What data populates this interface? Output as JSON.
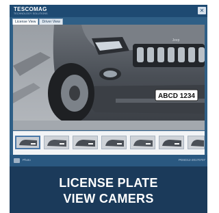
{
  "app": {
    "brand": "TESCOMAG",
    "brand_sub": "TECHNOLOGY SOLUTIONS",
    "window_button": "✕",
    "tabs": [
      {
        "label": "License View",
        "active": true
      },
      {
        "label": "Driver View",
        "active": false
      }
    ],
    "plate_text": "ABCD 1234",
    "grille_badge": "Jeep",
    "status_left": "Photo",
    "status_right": "PDSD12-20170707"
  },
  "caption": {
    "line1": "LICENSE PLATE",
    "line2": "VIEW CAMERS"
  },
  "colors": {
    "titlebar": "#1e4a72",
    "caption_bg": "#1b3a5a",
    "car_body": "#4a4f56",
    "plate_bg": "#ffffff"
  }
}
